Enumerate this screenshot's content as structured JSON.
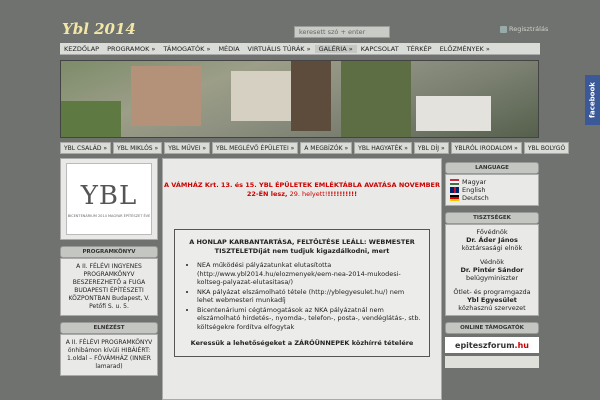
{
  "header": {
    "title": "Ybl 2014",
    "search_placeholder": "keresett szó + enter",
    "register": "Regisztrálás"
  },
  "nav1": [
    "KEZDŐLAP",
    "PROGRAMOK »",
    "TÁMOGATÓK »",
    "MÉDIA",
    "VIRTUÁLIS TÚRÁK »",
    "GALÉRIA »",
    "KAPCSOLAT",
    "TÉRKÉP",
    "ELŐZMÉNYEK »"
  ],
  "nav2": [
    "YBL CSALÁD »",
    "YBL MIKLÓS »",
    "YBL MŰVEI »",
    "YBL MEGLÉVŐ ÉPÜLETEI »",
    "A MEGBÍZÓK »",
    "YBL HAGYATÉK »",
    "YBL DÍJ »",
    "YBLRÓL IRODALOM »",
    "YBL BOLYGÓ"
  ],
  "facebook": "facebook",
  "left": {
    "logo_mark": "YBL",
    "logo_sub": "BICENTENÁRIUM 2014 MAGYAR ÉPÍTÉSZET ÉVE",
    "program_head": "PROGRAMKÖNYV",
    "program_body": "A II. FÉLÉVI INGYENES PROGRAMKÖNYV BESZEREZHETŐ a FUGA BUDAPESTI ÉPÍTÉSZETI KÖZPONTBAN Budapest, V. Petőfi S. u. 5.",
    "erratum_head": "ELNÉZÉST",
    "erratum_body": "A II. FÉLÉVI PROGRAMKÖNYV önhibámon kívüli HIBÁIÉRT: 1.oldal – FŐVÁMHÁZ (INNER lamarad)"
  },
  "center": {
    "notice_a": "A VÁMHÁZ Krt. 13. és 15. YBL ÉPÜLETEK EMLÉKTÁBLA AVATÁSA NOVEMBER 22-ÉN lesz,",
    "notice_b": " 29. helyett!",
    "notice_c": "!!!!!!!!!!",
    "maint_title": "A HONLAP KARBANTARTÁSA, FELTÖLTÉSE LEÁLL: WEBMESTER TISZTELETDíját nem tudjuk kigazdálkodni, mert",
    "items": [
      "NEA működési pályázatunkat elutasította (http://www.ybl2014.hu/elozmenyek/eem-nea-2014-mukodesi-koltseg-palyazat-elutasitasa/)",
      "NKA pályázat elszámolható tétele (http://yblegyesulet.hu/) nem lehet webmesteri munkadíj",
      "Bicentenáriumi cégtámogatások az NKA pályázatnál nem elszámolható hirdetés-, nyomda-, telefon-, posta-, vendéglátás-, stb. költségekre fordítva elfogytak"
    ],
    "maint_foot": "Keressük a lehetőségeket a ZÁRÓÜNNEPEK közhírré tételére"
  },
  "right": {
    "lang_head": "LANGUAGE",
    "langs": [
      "Magyar",
      "English",
      "Deutsch"
    ],
    "patrons_head": "TISZTSÉGEK",
    "patrons": [
      {
        "role": "Fővédnök",
        "name": "Dr. Áder János",
        "desc": "köztársasági elnök"
      },
      {
        "role": "Védnök",
        "name": "Dr. Pintér Sándor",
        "desc": "belügyminiszter"
      },
      {
        "role": "Ötlet- és programgazda",
        "name": "Ybl Egyesület",
        "desc": "közhasznú szervezet"
      }
    ],
    "support_head": "ONLINE TÁMOGATÓK",
    "ef_logo_a": "epiteszforum",
    "ef_logo_b": ".hu"
  }
}
